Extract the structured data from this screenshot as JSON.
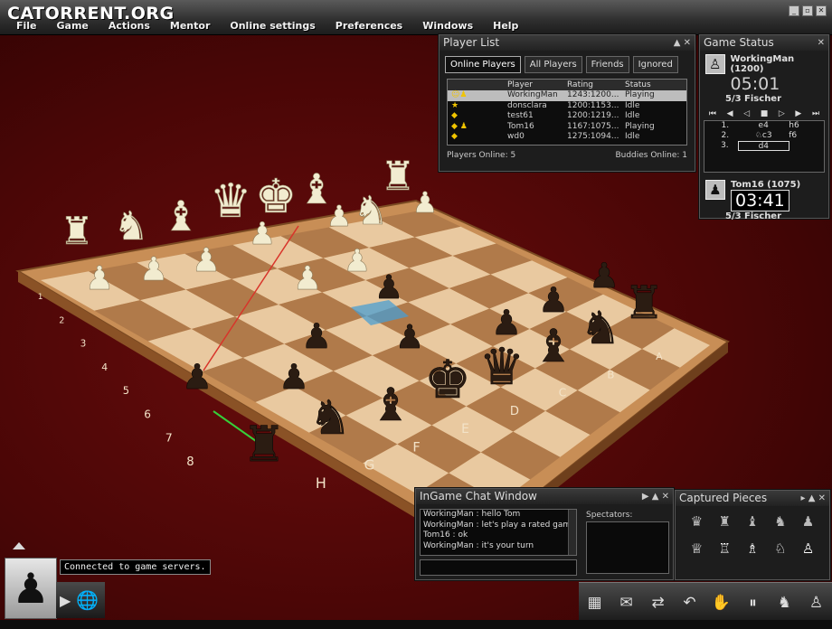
{
  "app": {
    "logo_text": "CATORRENT.ORG"
  },
  "menu": [
    "File",
    "Game",
    "Actions",
    "Mentor",
    "Online settings",
    "Preferences",
    "Windows",
    "Help"
  ],
  "player_list": {
    "title": "Player List",
    "tabs": [
      "Online Players",
      "All Players",
      "Friends",
      "Ignored"
    ],
    "active_tab": "Online Players",
    "columns": [
      "Player",
      "Rating",
      "Status"
    ],
    "rows": [
      {
        "icon": "☺♟",
        "player": "WorkingMan",
        "rating": "1243:1200...",
        "status": "Playing",
        "selected": true
      },
      {
        "icon": "★",
        "player": "donsclara",
        "rating": "1200:1153...",
        "status": "Idle",
        "selected": false
      },
      {
        "icon": "◆",
        "player": "test61",
        "rating": "1200:1219...",
        "status": "Idle",
        "selected": false
      },
      {
        "icon": "◆ ♟",
        "player": "Tom16",
        "rating": "1167:1075...",
        "status": "Playing",
        "selected": false
      },
      {
        "icon": "◆",
        "player": "wd0",
        "rating": "1275:1094...",
        "status": "Idle",
        "selected": false
      }
    ],
    "players_online": "Players Online: 5",
    "buddies_online": "Buddies Online: 1"
  },
  "game_status": {
    "title": "Game Status",
    "white": {
      "name": "WorkingMan (1200)",
      "clock": "05:01",
      "type": "5/3 Fischer"
    },
    "black": {
      "name": "Tom16 (1075)",
      "clock": "03:41",
      "type": "5/3 Fischer"
    },
    "moves": [
      {
        "n": "1.",
        "w": "e4",
        "b": "h6"
      },
      {
        "n": "2.",
        "w": "♘c3",
        "b": "f6"
      },
      {
        "n": "3.",
        "w": "d4",
        "b": ""
      }
    ]
  },
  "chat": {
    "title": "InGame Chat Window",
    "lines": [
      "WorkingMan : hello Tom",
      "WorkingMan : let's play a rated game",
      "Tom16 : ok",
      "WorkingMan : it's your turn"
    ],
    "spectators_label": "Spectators:"
  },
  "captured": {
    "title": "Captured Pieces",
    "row1": [
      "♛",
      "♜",
      "♝",
      "♞",
      "♟"
    ],
    "row2": [
      "♕",
      "♖",
      "♗",
      "♘",
      "♙"
    ]
  },
  "status_message": "Connected to game servers.",
  "board": {
    "rank_labels": [
      "1",
      "2",
      "3",
      "4",
      "5",
      "6",
      "7",
      "8"
    ],
    "file_labels": [
      "A",
      "B",
      "C",
      "D",
      "E",
      "F",
      "G",
      "H"
    ]
  },
  "colors": {
    "background": "#5a0909",
    "board_light": "#e9c9a0",
    "board_dark": "#b07a4a",
    "frame": "#d8a26a",
    "white_piece": "#f2ecd0",
    "black_piece": "#2b1c12"
  }
}
